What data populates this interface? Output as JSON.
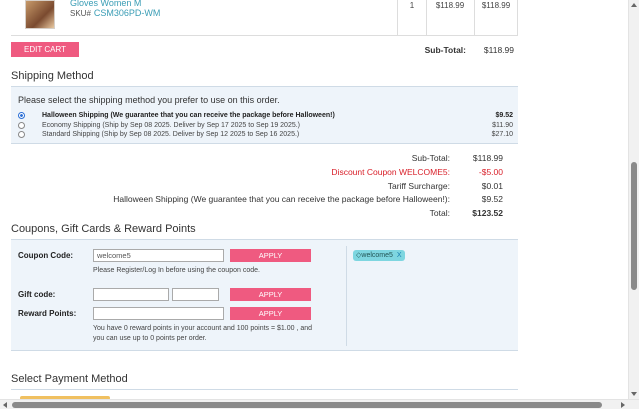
{
  "cart": {
    "product_name": "Gloves Women M",
    "sku_label": "SKU#",
    "sku_value": "CSM306PD-WM",
    "qty": "1",
    "unit_price": "$118.99",
    "line_total": "$118.99",
    "edit_cart_label": "EDIT CART",
    "subtotal_label": "Sub-Total:",
    "subtotal_value": "$118.99"
  },
  "shipping": {
    "title": "Shipping Method",
    "prompt": "Please select the shipping method you prefer to use on this order.",
    "options": [
      {
        "label": "Halloween Shipping  (We guarantee that you can receive the package before Halloween!)",
        "price": "$9.52",
        "selected": true
      },
      {
        "label": "Economy Shipping  (Ship by Sep 08 2025. Deliver by Sep 17 2025 to Sep 19 2025.)",
        "price": "$11.90",
        "selected": false
      },
      {
        "label": "Standard Shipping  (Ship by Sep 08 2025. Deliver by Sep 12 2025 to Sep 16 2025.)",
        "price": "$27.10",
        "selected": false
      }
    ]
  },
  "totals": {
    "subtotal_label": "Sub-Total:",
    "subtotal_value": "$118.99",
    "discount_label": "Discount Coupon WELCOME5:",
    "discount_value": "-$5.00",
    "tariff_label": "Tariff Surcharge:",
    "tariff_value": "$0.01",
    "shipping_label": "Halloween Shipping (We guarantee that you can receive the package before Halloween!):",
    "shipping_value": "$9.52",
    "total_label": "Total:",
    "total_value": "$123.52"
  },
  "coupons": {
    "title": "Coupons, Gift Cards & Reward Points",
    "coupon_label": "Coupon Code:",
    "coupon_value": "welcome5",
    "apply_label": "APPLY",
    "coupon_note": "Please Register/Log In before using the coupon code.",
    "gift_label": "Gift code:",
    "reward_label": "Reward Points:",
    "reward_note_1": "You have  0 reward points in your account and 100 points = $1.00 , and",
    "reward_note_2": "you can use up to 0 points per order.",
    "applied_tag": "welcome5",
    "applied_tag_remove": "X"
  },
  "payment": {
    "title": "Select Payment Method"
  },
  "colors": {
    "accent": "#ef5a80",
    "link": "#3a9db5",
    "panel": "#eef4fa",
    "discount": "#d9202a",
    "tag": "#7ed6e0"
  }
}
